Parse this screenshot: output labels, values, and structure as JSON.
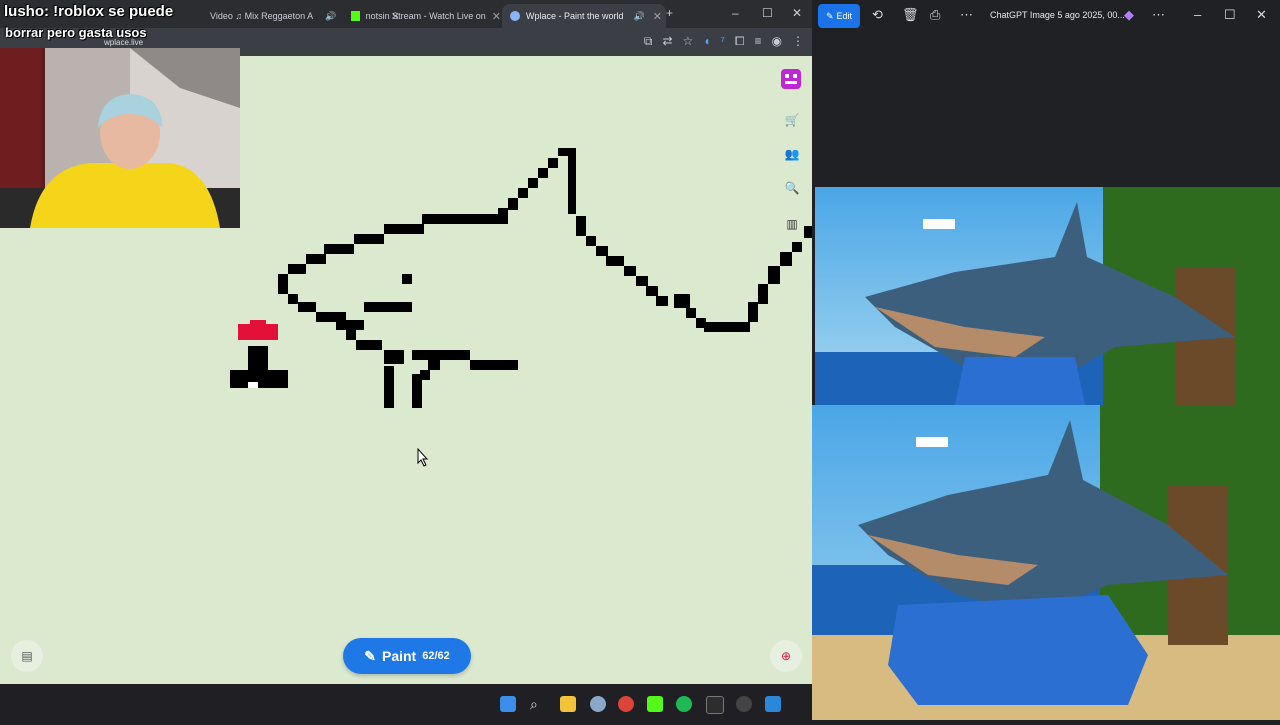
{
  "stream": {
    "overlay_line1": "lusho: !roblox se puede",
    "overlay_line2": "borrar pero gasta usos"
  },
  "browser": {
    "tabs": [
      {
        "label": "Video ♫ Mix Reggaeton A",
        "active": false
      },
      {
        "label": "notsin Stream - Watch Live on",
        "active": false
      },
      {
        "label": "Wplace - Paint the world",
        "active": true
      }
    ],
    "url": "wplace.live"
  },
  "wplace": {
    "paint_label": "Paint",
    "charges": "62/62"
  },
  "viewer": {
    "edit_label": "Edit",
    "title": "ChatGPT Image 5 ago 2025, 00..."
  },
  "colors": {
    "map_background": "#dbe9cf",
    "paint_button": "#1e78e6",
    "pixel_black": "#000000",
    "pixel_red": "#e3103a"
  },
  "icons": [
    "back-icon",
    "forward-icon",
    "reload-icon",
    "star-icon",
    "extensions-icon",
    "profile-icon",
    "menu-icon",
    "cart-icon",
    "friends-icon",
    "search-icon",
    "leaderboard-icon",
    "locate-icon",
    "layers-icon",
    "paintbrush-icon",
    "edit-icon",
    "rotate-icon",
    "delete-icon",
    "print-icon",
    "more-icon"
  ]
}
